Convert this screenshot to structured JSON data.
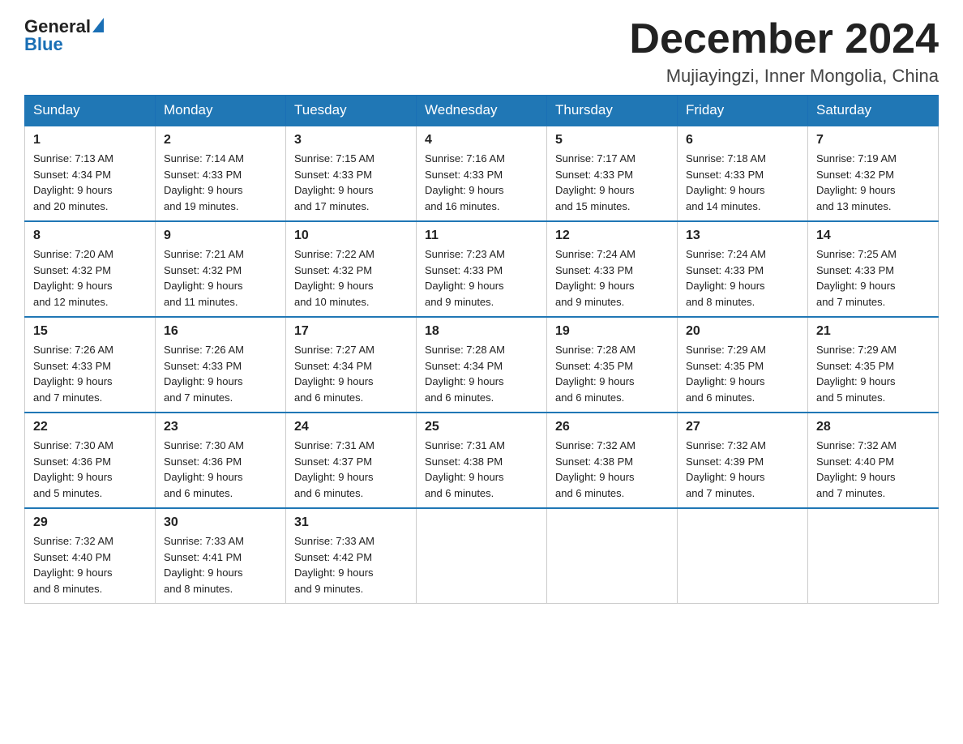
{
  "header": {
    "logo_general": "General",
    "logo_blue": "Blue",
    "month_title": "December 2024",
    "location": "Mujiayingzi, Inner Mongolia, China"
  },
  "days_of_week": [
    "Sunday",
    "Monday",
    "Tuesday",
    "Wednesday",
    "Thursday",
    "Friday",
    "Saturday"
  ],
  "weeks": [
    [
      {
        "day": "1",
        "sunrise": "7:13 AM",
        "sunset": "4:34 PM",
        "daylight": "9 hours and 20 minutes."
      },
      {
        "day": "2",
        "sunrise": "7:14 AM",
        "sunset": "4:33 PM",
        "daylight": "9 hours and 19 minutes."
      },
      {
        "day": "3",
        "sunrise": "7:15 AM",
        "sunset": "4:33 PM",
        "daylight": "9 hours and 17 minutes."
      },
      {
        "day": "4",
        "sunrise": "7:16 AM",
        "sunset": "4:33 PM",
        "daylight": "9 hours and 16 minutes."
      },
      {
        "day": "5",
        "sunrise": "7:17 AM",
        "sunset": "4:33 PM",
        "daylight": "9 hours and 15 minutes."
      },
      {
        "day": "6",
        "sunrise": "7:18 AM",
        "sunset": "4:33 PM",
        "daylight": "9 hours and 14 minutes."
      },
      {
        "day": "7",
        "sunrise": "7:19 AM",
        "sunset": "4:32 PM",
        "daylight": "9 hours and 13 minutes."
      }
    ],
    [
      {
        "day": "8",
        "sunrise": "7:20 AM",
        "sunset": "4:32 PM",
        "daylight": "9 hours and 12 minutes."
      },
      {
        "day": "9",
        "sunrise": "7:21 AM",
        "sunset": "4:32 PM",
        "daylight": "9 hours and 11 minutes."
      },
      {
        "day": "10",
        "sunrise": "7:22 AM",
        "sunset": "4:32 PM",
        "daylight": "9 hours and 10 minutes."
      },
      {
        "day": "11",
        "sunrise": "7:23 AM",
        "sunset": "4:33 PM",
        "daylight": "9 hours and 9 minutes."
      },
      {
        "day": "12",
        "sunrise": "7:24 AM",
        "sunset": "4:33 PM",
        "daylight": "9 hours and 9 minutes."
      },
      {
        "day": "13",
        "sunrise": "7:24 AM",
        "sunset": "4:33 PM",
        "daylight": "9 hours and 8 minutes."
      },
      {
        "day": "14",
        "sunrise": "7:25 AM",
        "sunset": "4:33 PM",
        "daylight": "9 hours and 7 minutes."
      }
    ],
    [
      {
        "day": "15",
        "sunrise": "7:26 AM",
        "sunset": "4:33 PM",
        "daylight": "9 hours and 7 minutes."
      },
      {
        "day": "16",
        "sunrise": "7:26 AM",
        "sunset": "4:33 PM",
        "daylight": "9 hours and 7 minutes."
      },
      {
        "day": "17",
        "sunrise": "7:27 AM",
        "sunset": "4:34 PM",
        "daylight": "9 hours and 6 minutes."
      },
      {
        "day": "18",
        "sunrise": "7:28 AM",
        "sunset": "4:34 PM",
        "daylight": "9 hours and 6 minutes."
      },
      {
        "day": "19",
        "sunrise": "7:28 AM",
        "sunset": "4:35 PM",
        "daylight": "9 hours and 6 minutes."
      },
      {
        "day": "20",
        "sunrise": "7:29 AM",
        "sunset": "4:35 PM",
        "daylight": "9 hours and 6 minutes."
      },
      {
        "day": "21",
        "sunrise": "7:29 AM",
        "sunset": "4:35 PM",
        "daylight": "9 hours and 5 minutes."
      }
    ],
    [
      {
        "day": "22",
        "sunrise": "7:30 AM",
        "sunset": "4:36 PM",
        "daylight": "9 hours and 5 minutes."
      },
      {
        "day": "23",
        "sunrise": "7:30 AM",
        "sunset": "4:36 PM",
        "daylight": "9 hours and 6 minutes."
      },
      {
        "day": "24",
        "sunrise": "7:31 AM",
        "sunset": "4:37 PM",
        "daylight": "9 hours and 6 minutes."
      },
      {
        "day": "25",
        "sunrise": "7:31 AM",
        "sunset": "4:38 PM",
        "daylight": "9 hours and 6 minutes."
      },
      {
        "day": "26",
        "sunrise": "7:32 AM",
        "sunset": "4:38 PM",
        "daylight": "9 hours and 6 minutes."
      },
      {
        "day": "27",
        "sunrise": "7:32 AM",
        "sunset": "4:39 PM",
        "daylight": "9 hours and 7 minutes."
      },
      {
        "day": "28",
        "sunrise": "7:32 AM",
        "sunset": "4:40 PM",
        "daylight": "9 hours and 7 minutes."
      }
    ],
    [
      {
        "day": "29",
        "sunrise": "7:32 AM",
        "sunset": "4:40 PM",
        "daylight": "9 hours and 8 minutes."
      },
      {
        "day": "30",
        "sunrise": "7:33 AM",
        "sunset": "4:41 PM",
        "daylight": "9 hours and 8 minutes."
      },
      {
        "day": "31",
        "sunrise": "7:33 AM",
        "sunset": "4:42 PM",
        "daylight": "9 hours and 9 minutes."
      },
      null,
      null,
      null,
      null
    ]
  ],
  "labels": {
    "sunrise": "Sunrise:",
    "sunset": "Sunset:",
    "daylight": "Daylight:"
  }
}
